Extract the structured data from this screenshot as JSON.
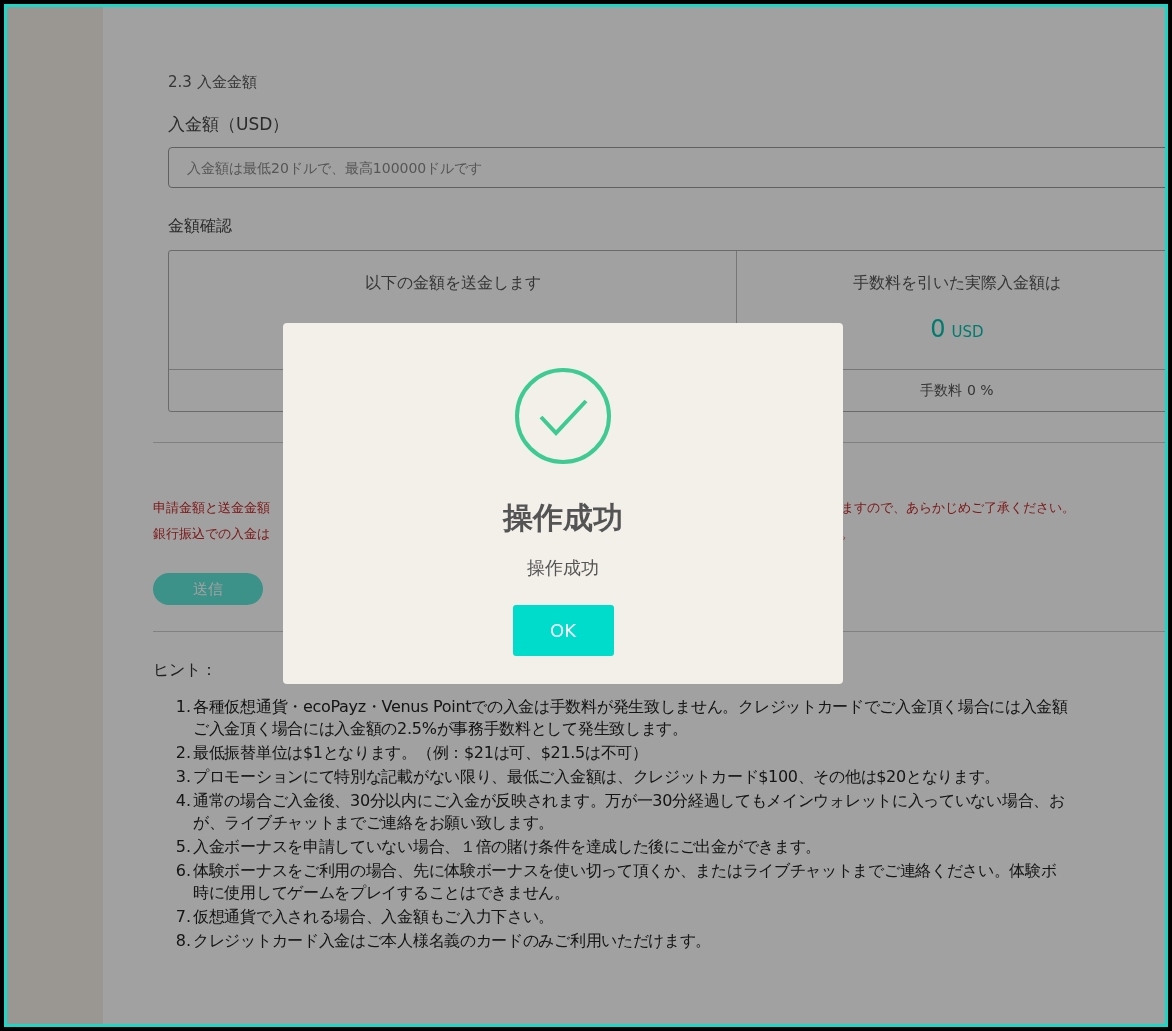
{
  "section_title": "2.3 入金金額",
  "amount_field": {
    "label": "入金額（USD）",
    "placeholder": "入金額は最低20ドルで、最高100000ドルです"
  },
  "confirm": {
    "title": "金額確認",
    "left": {
      "heading": "以下の金額を送金します"
    },
    "right": {
      "heading": "手数料を引いた実際入金額は",
      "value": "0",
      "unit": "USD",
      "fee": "手数料 0 %"
    }
  },
  "notices": [
    {
      "left": "申請金額と送金金額",
      "right": "ますので、あらかじめご了承ください。"
    },
    {
      "left": "銀行振込での入金は",
      "right": "。"
    }
  ],
  "submit_button": "送信",
  "hints": {
    "title": "ヒント：",
    "items": [
      {
        "number": "1.",
        "lines": [
          "各種仮想通貨・ecoPayz・Venus Pointでの入金は手数料が発生致しません。クレジットカードでご入金頂く場合には入金額",
          "ご入金頂く場合には入金額の2.5%が事務手数料として発生致します。"
        ]
      },
      {
        "number": "2.",
        "lines": [
          "最低振替単位は$1となります。（例：$21は可、$21.5は不可）"
        ]
      },
      {
        "number": "3.",
        "lines": [
          "プロモーションにて特別な記載がない限り、最低ご入金額は、クレジットカード$100、その他は$20となります。"
        ]
      },
      {
        "number": "4.",
        "lines": [
          "通常の場合ご入金後、30分以内にご入金が反映されます。万が一30分経過してもメインウォレットに入っていない場合、お",
          "が、ライブチャットまでご連絡をお願い致します。"
        ]
      },
      {
        "number": "5.",
        "lines": [
          "入金ボーナスを申請していない場合、１倍の賭け条件を達成した後にご出金ができます。"
        ]
      },
      {
        "number": "6.",
        "lines": [
          "体験ボーナスをご利用の場合、先に体験ボーナスを使い切って頂くか、またはライブチャットまでご連絡ください。体験ボ",
          "時に使用してゲームをプレイすることはできません。"
        ]
      },
      {
        "number": "7.",
        "lines": [
          "仮想通貨で入される場合、入金額もご入力下さい。"
        ]
      },
      {
        "number": "8.",
        "lines": [
          "クレジットカード入金はご本人様名義のカードのみご利用いただけます。"
        ]
      }
    ]
  },
  "dialog": {
    "title": "操作成功",
    "message": "操作成功",
    "ok_button": "OK"
  }
}
